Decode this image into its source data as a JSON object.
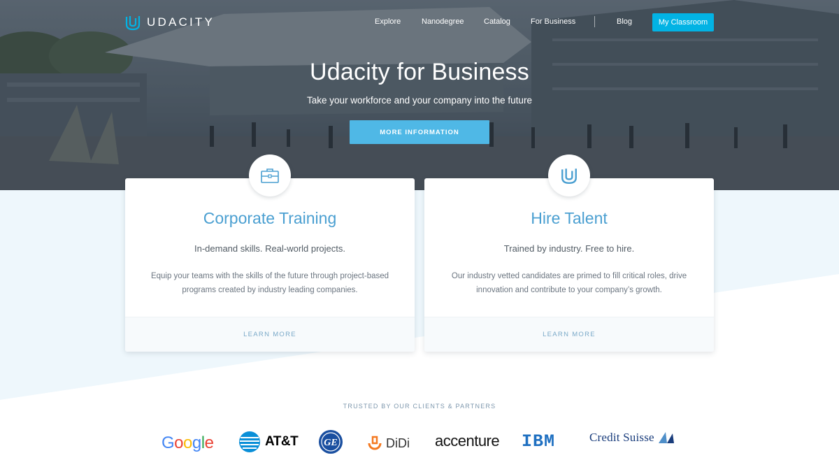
{
  "brand": {
    "name": "UDACITY",
    "accent": "#02b3e4"
  },
  "nav": {
    "items": [
      "Explore",
      "Nanodegree",
      "Catalog",
      "For Business",
      "Blog"
    ],
    "cta": "My Classroom"
  },
  "hero": {
    "title": "Udacity for Business",
    "subtitle": "Take your workforce and your company into the future",
    "button": "MORE INFORMATION"
  },
  "cards": [
    {
      "icon": "briefcase-icon",
      "title": "Corporate Training",
      "tagline": "In-demand skills. Real-world projects.",
      "description": "Equip your teams with the skills of the future through project-based programs created by industry leading companies.",
      "link": "LEARN MORE"
    },
    {
      "icon": "udacity-u-icon",
      "title": "Hire Talent",
      "tagline": "Trained by industry. Free to hire.",
      "description": "Our industry vetted candidates are primed to fill critical roles, drive innovation and contribute to your company’s growth.",
      "link": "LEARN MORE"
    }
  ],
  "partners": {
    "heading": "TRUSTED BY OUR CLIENTS & PARTNERS",
    "logos": [
      "Google",
      "AT&T",
      "GE",
      "DiDi",
      "accenture",
      "IBM",
      "Credit Suisse"
    ]
  }
}
